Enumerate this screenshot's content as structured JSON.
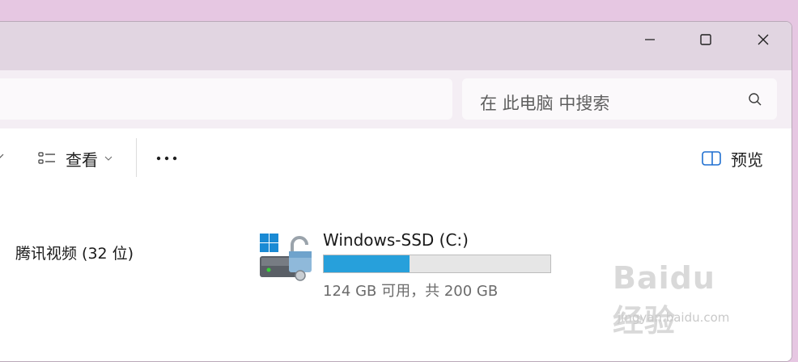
{
  "search": {
    "placeholder": "在 此电脑 中搜索"
  },
  "toolbar": {
    "view_label": "查看",
    "preview_label": "预览"
  },
  "content": {
    "left_item_label": "腾讯视频 (32 位)",
    "drive": {
      "name": "Windows-SSD (C:)",
      "used_fraction": 0.38,
      "size_text": "124 GB 可用，共 200 GB"
    }
  },
  "watermark": {
    "main": "Baidu 经验",
    "sub": "jingyan.baidu.com"
  },
  "colors": {
    "accent": "#27a0db",
    "window_bg": "#e1d5e1",
    "desktop": "#e6c7e2"
  }
}
